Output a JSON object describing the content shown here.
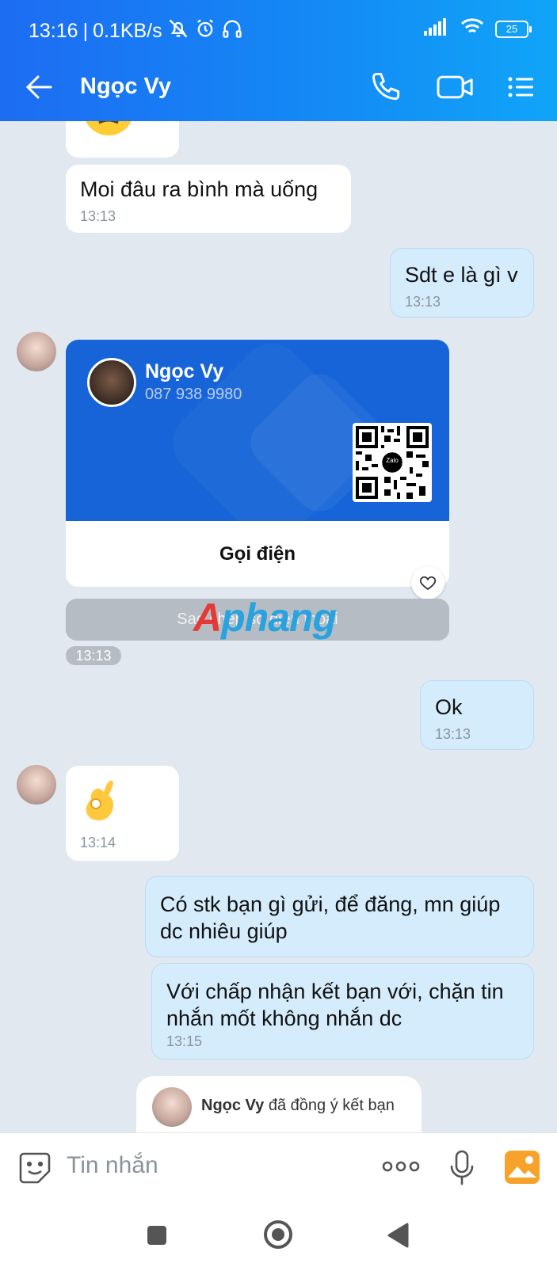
{
  "status_bar": {
    "time": "13:16",
    "network_speed": "0.1KB/s",
    "battery": "25"
  },
  "app_bar": {
    "title": "Ngọc Vy"
  },
  "messages": [
    {
      "id": "m1",
      "direction": "in",
      "text": "Moi đâu ra bình mà uống",
      "time": "13:13"
    },
    {
      "id": "m2",
      "direction": "out",
      "text": "Sdt e là gì v",
      "time": "13:13"
    },
    {
      "id": "m3",
      "direction": "out",
      "text": "Ok",
      "time": "13:13"
    },
    {
      "id": "m4",
      "direction": "in",
      "emoji": "👌",
      "time": "13:14"
    },
    {
      "id": "m5",
      "direction": "out",
      "text": "Có stk bạn gì gửi, để đăng, mn giúp dc nhiêu giúp"
    },
    {
      "id": "m6",
      "direction": "out",
      "text": "Với chấp nhận kết bạn với, chặn tin nhắn mốt không nhắn dc",
      "time": "13:15"
    }
  ],
  "contact_card": {
    "name": "Ngọc Vy",
    "phone": "087 938 9980",
    "qr_label": "Zalo",
    "action_label": "Gọi điện",
    "copy_label": "Sao chép số điện thoại",
    "time": "13:13"
  },
  "watermark": {
    "part_a": "A",
    "part_b": "phang"
  },
  "system_message": {
    "name": "Ngọc Vy",
    "text": "đã đồng ý kết bạn"
  },
  "input_bar": {
    "placeholder": "Tin nhắn"
  },
  "colors": {
    "header_gradient_start": "#1d6cf2",
    "header_gradient_end": "#10a5f8",
    "chat_background": "#e2e8f0",
    "outgoing_bubble": "#d4ecfb",
    "card_blue": "#1664d8"
  },
  "icons": [
    "back-arrow-icon",
    "phone-icon",
    "video-call-icon",
    "menu-icon",
    "sticker-icon",
    "more-icon",
    "microphone-icon",
    "image-icon",
    "heart-icon"
  ]
}
